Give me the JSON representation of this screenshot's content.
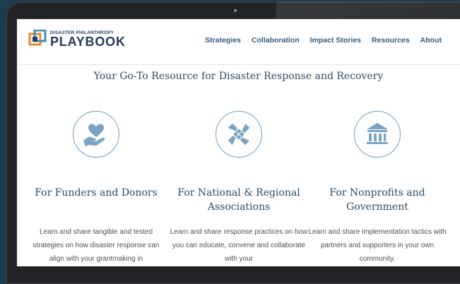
{
  "header": {
    "logo_small": "DISASTER PHILANTHROPY",
    "logo_big": "PLAYBOOK"
  },
  "nav": {
    "items": [
      "Strategies",
      "Collaboration",
      "Impact Stories",
      "Resources",
      "About"
    ]
  },
  "main": {
    "tagline": "Your Go-To Resource for Disaster Response and Recovery",
    "cards": [
      {
        "title": "For Funders and Donors",
        "text": "Learn and share tangible and tested strategies on how disaster response can align with your grantmaking in",
        "icon": "heart-hand-icon"
      },
      {
        "title": "For National & Regional Associations",
        "text": "Learn and share response practices on how you can educate, convene and collaborate with your",
        "icon": "joined-hands-icon"
      },
      {
        "title": "For Nonprofits and Government",
        "text": "Learn and share implementation tactics with partners and supporters in your own community.",
        "icon": "government-building-icon"
      }
    ]
  },
  "colors": {
    "brand_navy": "#233b5d",
    "nav_blue": "#2b5d86",
    "icon_blue": "#6e9cc0",
    "logo_orange": "#e8872e",
    "logo_teal": "#3f8fb5"
  }
}
